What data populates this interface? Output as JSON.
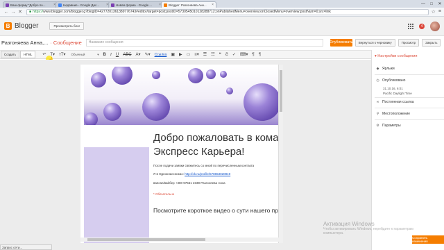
{
  "browser": {
    "tabs": [
      {
        "label": "Ваш форму \"Добро по...",
        "color": "#7b3fb1",
        "active": false
      },
      {
        "label": "Недавние - Google Дис...",
        "color": "#4285f4",
        "active": false
      },
      {
        "label": "Новая форма - Google ...",
        "color": "#7b3fb1",
        "active": false
      },
      {
        "label": "Blogger: Разгоняева Анн...",
        "color": "#f57d00",
        "active": true
      }
    ],
    "url_prefix": "https://",
    "url": "www.blogger.com/blogger.g?blogID=4277201361389776743#editor/target=post;postID=5730545010128288712;onPublishedMenu=overview;onClosedMenu=overview;postNum=0;src=link",
    "window_controls": [
      "—",
      "□",
      "✕"
    ]
  },
  "header": {
    "logo_letter": "B",
    "app_name": "Blogger",
    "view_blog": "Просмотреть блог",
    "notif_count": "4"
  },
  "post": {
    "blog_name": "Разгоняева Анна,...",
    "post_type": "· Сообщение",
    "title_placeholder": "Название сообщения",
    "publish": "Опубликовать",
    "revert_draft": "Вернуться к черновику",
    "preview": "Просмотр",
    "close": "Закрыть"
  },
  "toolbar": {
    "compose": "Создать",
    "html": "HTML",
    "font": "Обычный",
    "link": "Ссылка"
  },
  "content": {
    "welcome": "Добро пожаловать в коман",
    "welcome2": "Экспресс Карьера!",
    "line1": "После подачи заявки свяжитесь со мной по перечисленным контакта",
    "line2_prefix": "Я в Одноклассниках:",
    "line2_link": "http://ok.ru/profile/578653020840",
    "line3": "вапсап/вайбер +380 97561 2339 Разгоняева Анна",
    "required": "* Обязательно",
    "sub": "Посмотрите короткое видео о сути нашего пр"
  },
  "settings": {
    "title": "Настройки сообщения",
    "labels": "Ярлыки",
    "published": "Опубликовано",
    "date": "31.10.16, 6:01",
    "timezone": "Pacific Daylight Time",
    "permalink": "Постоянная ссылка",
    "location": "Местоположение",
    "options": "Параметры"
  },
  "watermark": {
    "line1": "Активация Windows",
    "line2": "Чтобы активировать Windows, перейдите к параметрам",
    "line3": "компьютера."
  },
  "toast": "Сохранить изменения",
  "status": "Запрос сети..."
}
